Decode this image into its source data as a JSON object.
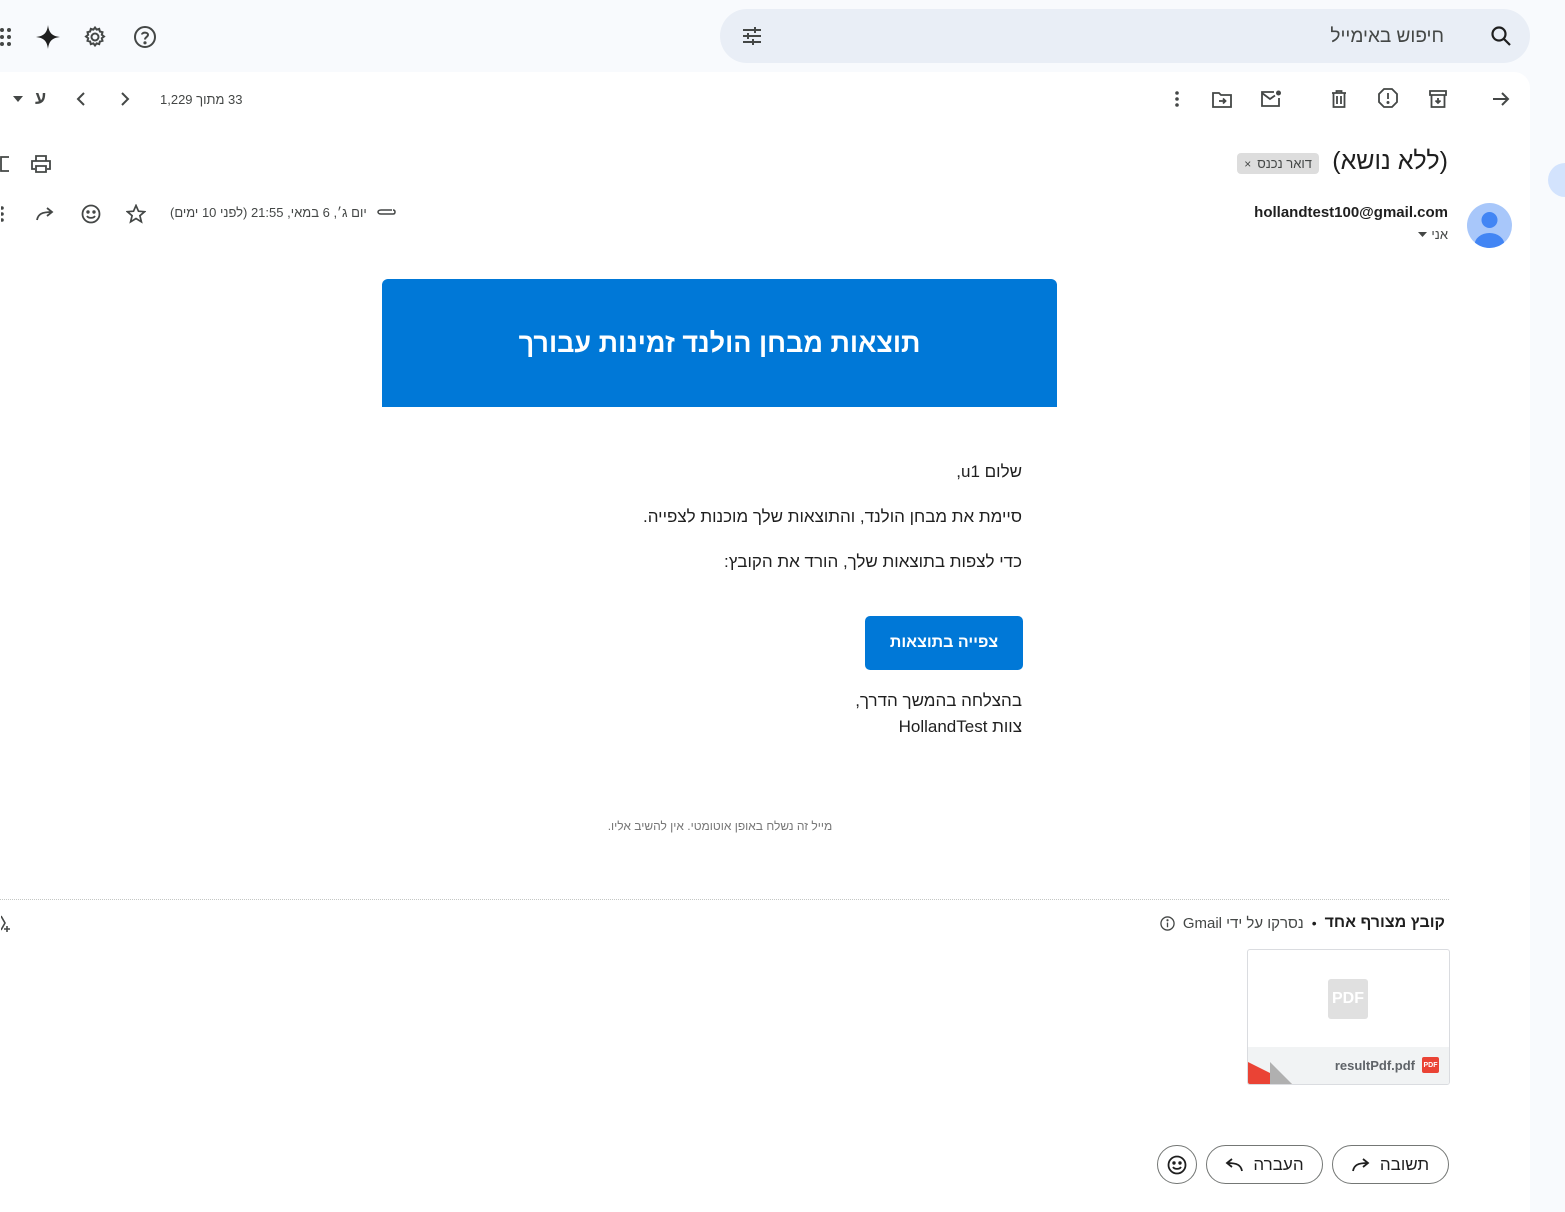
{
  "search": {
    "placeholder": "חיפוש באימייל",
    "search_icon": "search-icon",
    "filter_icon": "tune-icon"
  },
  "top_icons": [
    "apps-icon",
    "gemini-sparkle-icon",
    "settings-gear-icon",
    "help-icon"
  ],
  "toolbar": {
    "pagination": "33 מתוך 1,229",
    "input_tool_label": "ע",
    "actions": [
      "back-arrow-icon",
      "archive-icon",
      "report-spam-icon",
      "delete-icon",
      "mark-unread-icon",
      "move-to-icon",
      "more-vert-icon"
    ]
  },
  "email": {
    "subject": "(ללא נושא)",
    "label_chip": "דואר נכנס",
    "sender": "hollandtest100@gmail.com",
    "to": "אני",
    "date": "יום ג׳, 6 במאי, 21:55 (לפני 10 ימים)"
  },
  "body": {
    "banner_title": "תוצאות מבחן הולנד זמינות עבורך",
    "greeting": "שלום u1,",
    "line1": "סיימת את מבחן הולנד, והתוצאות שלך מוכנות לצפייה.",
    "line2": "כדי לצפות בתוצאות שלך, הורד את הקובץ:",
    "cta_label": "צפייה בתוצאות",
    "signoff": "בהצלחה בהמשך הדרך,",
    "team": "צוות HollandTest",
    "footnote": "מייל זה נשלח באופן אוטומטי. אין להשיב אליו."
  },
  "attachments": {
    "title": "קובץ מצורף אחד",
    "separator": "•",
    "scanned": "נסרקו על ידי Gmail",
    "file_name": "resultPdf.pdf",
    "thumb_text": "PDF",
    "badge_text": "PDF"
  },
  "actions": {
    "reply": "תשובה",
    "forward": "העברה"
  },
  "colors": {
    "banner": "#0078d7",
    "background": "#f8fafd",
    "search_bg": "#e9eef6",
    "pdf_red": "#ea4335"
  }
}
